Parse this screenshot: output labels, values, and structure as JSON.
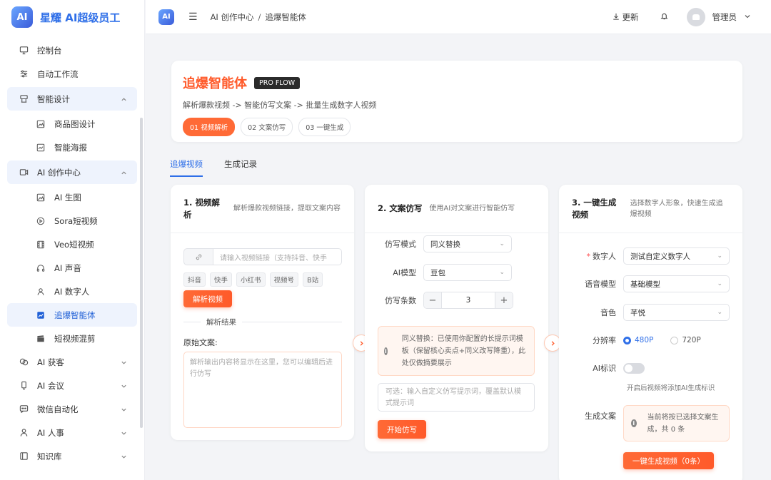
{
  "brand": {
    "logo_text": "AI",
    "name": "星耀 AI超级员工"
  },
  "sidebar": {
    "items": [
      {
        "label": "控制台",
        "icon": "monitor-icon"
      },
      {
        "label": "自动工作流",
        "icon": "sliders-icon"
      },
      {
        "label": "智能设计",
        "icon": "palette-icon",
        "open": true
      },
      {
        "label": "商品图设计",
        "icon": "image-icon",
        "sub": true
      },
      {
        "label": "智能海报",
        "icon": "poster-icon",
        "sub": true
      },
      {
        "label": "AI 创作中心",
        "icon": "video-icon",
        "open": true
      },
      {
        "label": "AI 生图",
        "icon": "image-icon",
        "sub": true
      },
      {
        "label": "Sora短视频",
        "icon": "play-circle-icon",
        "sub": true
      },
      {
        "label": "Veo短视频",
        "icon": "film-icon",
        "sub": true
      },
      {
        "label": "AI 声音",
        "icon": "headphones-icon",
        "sub": true
      },
      {
        "label": "AI 数字人",
        "icon": "user-icon",
        "sub": true
      },
      {
        "label": "追爆智能体",
        "icon": "trend-chart-icon",
        "sub": true,
        "active": true
      },
      {
        "label": "短视频混剪",
        "icon": "clapper-icon",
        "sub": true
      },
      {
        "label": "AI 获客",
        "icon": "customer-icon"
      },
      {
        "label": "AI 会议",
        "icon": "meeting-icon"
      },
      {
        "label": "微信自动化",
        "icon": "chat-icon"
      },
      {
        "label": "AI 人事",
        "icon": "person-icon"
      },
      {
        "label": "知识库",
        "icon": "book-icon"
      }
    ]
  },
  "topbar": {
    "breadcrumb": [
      "AI 创作中心",
      "追爆智能体"
    ],
    "refresh": "更新",
    "user": "管理员"
  },
  "hero": {
    "title": "追爆智能体",
    "badge": "PRO FLOW",
    "subtitle": "解析爆款视频 -> 智能仿写文案 -> 批量生成数字人视频",
    "steps": [
      "01 视频解析",
      "02 文案仿写",
      "03 一键生成"
    ]
  },
  "tabs": [
    "追爆视频",
    "生成记录"
  ],
  "card1": {
    "title": "1. 视频解析",
    "desc": "解析爆款视频链接，提取文案内容",
    "link_placeholder": "请输入视频链接（支持抖音、快手",
    "platforms": [
      "抖音",
      "快手",
      "小红书",
      "视频号",
      "B站"
    ],
    "parse_button": "解析视频",
    "result_label": "解析结果",
    "orig_label": "原始文案:",
    "orig_placeholder": "解析输出内容将显示在这里，您可以编辑后进行仿写"
  },
  "card2": {
    "title": "2. 文案仿写",
    "desc": "使用AI对文案进行智能仿写",
    "mode_label": "仿写模式",
    "mode_value": "同义替换",
    "model_label": "AI模型",
    "model_value": "豆包",
    "count_label": "仿写条数",
    "count_value": "3",
    "notice": "同义替换：已使用你配置的长提示词模板（保留核心卖点+同义改写降重），此处仅做摘要展示",
    "custom_placeholder": "可选：输入自定义仿写提示词，覆盖默认模式提示词",
    "start_button": "开始仿写"
  },
  "card3": {
    "title": "3. 一键生成视频",
    "desc": "选择数字人形象，快速生成追爆视频",
    "avatar_label": "数字人",
    "avatar_value": "测试自定义数字人",
    "voice_model_label": "语音模型",
    "voice_model_value": "基础模型",
    "timbre_label": "音色",
    "timbre_value": "芊悦",
    "resolution_label": "分辨率",
    "res_480": "480P",
    "res_720": "720P",
    "ai_mark_label": "AI标识",
    "ai_mark_hint": "开启后视频将添加AI生成标识",
    "gen_text_label": "生成文案",
    "gen_text_notice": "当前将按已选择文案生成，共 0 条",
    "generate_button": "一键生成视频（0条）"
  },
  "colors": {
    "accent": "#2f6fe8",
    "orange": "#ff5a2a"
  }
}
